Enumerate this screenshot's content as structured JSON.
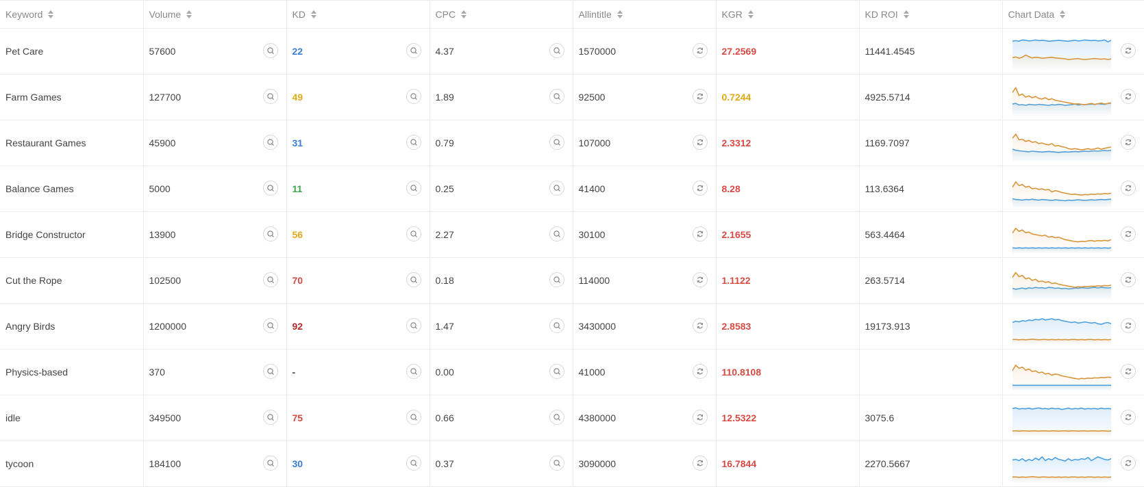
{
  "columns": [
    {
      "label": "Keyword"
    },
    {
      "label": "Volume"
    },
    {
      "label": "KD"
    },
    {
      "label": "CPC"
    },
    {
      "label": "Allintitle"
    },
    {
      "label": "KGR"
    },
    {
      "label": "KD ROI"
    },
    {
      "label": "Chart Data"
    }
  ],
  "colors": {
    "blue": "#3a7bd5",
    "yellow": "#e0a915",
    "green": "#3aa54f",
    "red": "#d74a44",
    "darkred": "#b32c2c",
    "line_blue": "#4a9fe0",
    "line_orange": "#d9953b"
  },
  "rows": [
    {
      "keyword": "Pet Care",
      "volume": "57600",
      "kd": "22",
      "kd_color": "#3a7bd5",
      "cpc": "4.37",
      "allintitle": "1570000",
      "kgr": "27.2569",
      "kgr_color": "#d74a44",
      "kd_roi": "11441.4545",
      "chart": {
        "blue": [
          82,
          84,
          82,
          86,
          85,
          83,
          84,
          86,
          84,
          85,
          84,
          82,
          83,
          84,
          85,
          84,
          83,
          82,
          84,
          85,
          83,
          84,
          86,
          85,
          84,
          85,
          83,
          84,
          86,
          80,
          85
        ],
        "orange": [
          30,
          32,
          28,
          31,
          38,
          33,
          29,
          31,
          30,
          28,
          29,
          30,
          31,
          29,
          28,
          27,
          26,
          24,
          25,
          26,
          27,
          25,
          24,
          25,
          26,
          27,
          26,
          25,
          26,
          24,
          26
        ]
      }
    },
    {
      "keyword": "Farm Games",
      "volume": "127700",
      "kd": "49",
      "kd_color": "#e0a915",
      "cpc": "1.89",
      "allintitle": "92500",
      "kgr": "0.7244",
      "kgr_color": "#e0a915",
      "kd_roi": "4925.5714",
      "chart": {
        "blue": [
          28,
          30,
          25,
          26,
          24,
          27,
          26,
          25,
          27,
          26,
          25,
          24,
          26,
          25,
          27,
          26,
          24,
          25,
          26,
          28,
          25,
          27,
          26,
          27,
          28,
          27,
          29,
          28,
          27,
          30,
          31
        ],
        "orange": [
          65,
          80,
          55,
          60,
          50,
          54,
          48,
          52,
          46,
          44,
          48,
          42,
          45,
          40,
          38,
          36,
          34,
          32,
          30,
          28,
          29,
          27,
          26,
          28,
          30,
          27,
          29,
          31,
          28,
          30,
          32
        ]
      }
    },
    {
      "keyword": "Restaurant Games",
      "volume": "45900",
      "kd": "31",
      "kd_color": "#3a7bd5",
      "cpc": "0.79",
      "allintitle": "107000",
      "kgr": "2.3312",
      "kgr_color": "#d74a44",
      "kd_roi": "1169.7097",
      "chart": {
        "blue": [
          30,
          27,
          25,
          24,
          23,
          22,
          24,
          23,
          22,
          21,
          22,
          23,
          22,
          21,
          20,
          21,
          22,
          21,
          22,
          23,
          22,
          23,
          24,
          23,
          24,
          25,
          24,
          25,
          26,
          25,
          27
        ],
        "orange": [
          65,
          78,
          60,
          62,
          55,
          58,
          52,
          54,
          48,
          50,
          46,
          44,
          48,
          40,
          42,
          38,
          36,
          32,
          30,
          32,
          30,
          28,
          30,
          32,
          29,
          31,
          34,
          30,
          33,
          35,
          37
        ]
      }
    },
    {
      "keyword": "Balance Games",
      "volume": "5000",
      "kd": "11",
      "kd_color": "#3aa54f",
      "cpc": "0.25",
      "allintitle": "41400",
      "kgr": "8.28",
      "kgr_color": "#d74a44",
      "kd_roi": "113.6364",
      "chart": {
        "blue": [
          18,
          16,
          15,
          14,
          16,
          15,
          17,
          15,
          14,
          16,
          15,
          14,
          13,
          15,
          14,
          13,
          12,
          14,
          13,
          14,
          15,
          14,
          13,
          14,
          15,
          14,
          15,
          16,
          15,
          16,
          17
        ],
        "orange": [
          55,
          72,
          60,
          64,
          55,
          58,
          50,
          52,
          48,
          50,
          46,
          48,
          40,
          44,
          42,
          38,
          36,
          34,
          32,
          33,
          31,
          30,
          32,
          31,
          33,
          32,
          34,
          33,
          35,
          34,
          36
        ]
      }
    },
    {
      "keyword": "Bridge Constructor",
      "volume": "13900",
      "kd": "56",
      "kd_color": "#e0a915",
      "cpc": "2.27",
      "allintitle": "30100",
      "kgr": "2.1655",
      "kgr_color": "#d74a44",
      "kd_roi": "563.4464",
      "chart": {
        "blue": [
          8,
          7,
          8,
          7,
          8,
          7,
          8,
          7,
          8,
          7,
          8,
          7,
          8,
          7,
          8,
          7,
          8,
          7,
          8,
          7,
          8,
          7,
          8,
          7,
          8,
          7,
          8,
          7,
          8,
          7,
          8
        ],
        "orange": [
          55,
          70,
          60,
          65,
          56,
          58,
          52,
          50,
          48,
          46,
          48,
          42,
          44,
          40,
          42,
          38,
          34,
          32,
          30,
          28,
          27,
          29,
          28,
          30,
          31,
          29,
          31,
          30,
          32,
          30,
          34
        ]
      }
    },
    {
      "keyword": "Cut the Rope",
      "volume": "102500",
      "kd": "70",
      "kd_color": "#d74a44",
      "cpc": "0.18",
      "allintitle": "114000",
      "kgr": "1.1122",
      "kgr_color": "#d74a44",
      "kd_roi": "263.5714",
      "chart": {
        "blue": [
          25,
          22,
          24,
          26,
          23,
          27,
          25,
          28,
          26,
          27,
          25,
          28,
          27,
          25,
          26,
          24,
          25,
          23,
          24,
          26,
          25,
          27,
          26,
          25,
          27,
          28,
          26,
          28,
          27,
          26,
          27
        ],
        "orange": [
          60,
          75,
          62,
          66,
          55,
          58,
          50,
          54,
          46,
          48,
          44,
          46,
          40,
          42,
          38,
          36,
          34,
          32,
          30,
          28,
          30,
          29,
          31,
          30,
          32,
          31,
          33,
          32,
          34,
          33,
          35
        ]
      }
    },
    {
      "keyword": "Angry Birds",
      "volume": "1200000",
      "kd": "92",
      "kd_color": "#b32c2c",
      "cpc": "1.47",
      "allintitle": "3430000",
      "kgr": "2.8583",
      "kgr_color": "#d74a44",
      "kd_roi": "19173.913",
      "chart": {
        "blue": [
          62,
          66,
          64,
          68,
          66,
          70,
          68,
          72,
          70,
          74,
          70,
          72,
          74,
          70,
          72,
          68,
          66,
          64,
          62,
          64,
          60,
          62,
          64,
          62,
          60,
          62,
          58,
          56,
          60,
          62,
          58
        ],
        "orange": [
          8,
          8,
          7,
          8,
          7,
          8,
          9,
          8,
          7,
          8,
          8,
          7,
          8,
          7,
          8,
          7,
          8,
          7,
          8,
          8,
          7,
          8,
          7,
          8,
          8,
          7,
          8,
          7,
          8,
          7,
          8
        ]
      }
    },
    {
      "keyword": "Physics-based",
      "volume": "370",
      "kd": "-",
      "kd_color": "#444444",
      "cpc": "0.00",
      "allintitle": "41000",
      "kgr": "110.8108",
      "kgr_color": "#d74a44",
      "kd_roi": "",
      "chart": {
        "blue": [
          8,
          8,
          8,
          8,
          8,
          8,
          8,
          8,
          8,
          8,
          8,
          8,
          8,
          8,
          8,
          8,
          8,
          8,
          8,
          8,
          8,
          8,
          8,
          8,
          8,
          8,
          8,
          8,
          8,
          8,
          8
        ],
        "orange": [
          55,
          72,
          62,
          66,
          56,
          60,
          52,
          54,
          48,
          50,
          44,
          46,
          40,
          44,
          42,
          38,
          36,
          34,
          32,
          30,
          28,
          30,
          29,
          31,
          30,
          32,
          31,
          33,
          32,
          34,
          33
        ]
      }
    },
    {
      "keyword": "idle",
      "volume": "349500",
      "kd": "75",
      "kd_color": "#d74a44",
      "cpc": "0.66",
      "allintitle": "4380000",
      "kgr": "12.5322",
      "kgr_color": "#d74a44",
      "kd_roi": "3075.6",
      "chart": {
        "blue": [
          80,
          82,
          78,
          80,
          79,
          81,
          78,
          80,
          82,
          79,
          80,
          78,
          81,
          79,
          80,
          77,
          79,
          81,
          78,
          80,
          79,
          81,
          78,
          80,
          79,
          80,
          78,
          81,
          79,
          80,
          79
        ],
        "orange": [
          9,
          9,
          8,
          9,
          9,
          8,
          9,
          9,
          8,
          9,
          9,
          8,
          9,
          9,
          8,
          9,
          9,
          8,
          9,
          9,
          8,
          9,
          9,
          8,
          9,
          9,
          8,
          9,
          9,
          8,
          9
        ]
      }
    },
    {
      "keyword": "tycoon",
      "volume": "184100",
      "kd": "30",
      "kd_color": "#3a7bd5",
      "cpc": "0.37",
      "allintitle": "3090000",
      "kgr": "16.7844",
      "kgr_color": "#d74a44",
      "kd_roi": "2270.5667",
      "chart": {
        "blue": [
          62,
          64,
          60,
          66,
          58,
          64,
          60,
          68,
          62,
          72,
          60,
          66,
          62,
          70,
          64,
          62,
          58,
          66,
          60,
          64,
          62,
          66,
          64,
          70,
          60,
          66,
          72,
          68,
          64,
          62,
          66
        ],
        "orange": [
          8,
          8,
          7,
          8,
          7,
          8,
          9,
          8,
          7,
          8,
          8,
          7,
          8,
          7,
          8,
          7,
          8,
          7,
          8,
          8,
          7,
          8,
          7,
          8,
          8,
          7,
          8,
          7,
          8,
          7,
          8
        ]
      }
    }
  ]
}
